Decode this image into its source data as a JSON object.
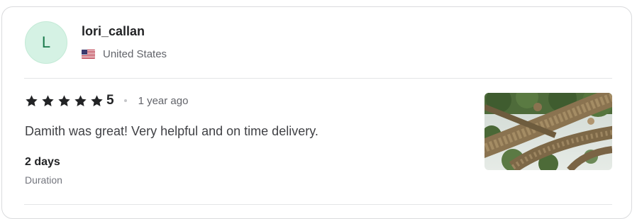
{
  "reviewer": {
    "avatar_initial": "L",
    "username": "lori_callan",
    "country": "United States",
    "flag_icon": "us-flag-icon"
  },
  "review": {
    "rating": "5",
    "stars_filled": 5,
    "stars_total": 5,
    "time_ago": "1 year ago",
    "text": "Damith was great! Very helpful and on time delivery.",
    "duration_value": "2 days",
    "duration_label": "Duration"
  },
  "colors": {
    "avatar_bg": "#d5f2e4",
    "avatar_text": "#1a7a4c",
    "star": "#222325",
    "card_border": "#dadbdd"
  },
  "icons": {
    "star": "star-icon",
    "separator": "dot-separator",
    "thumbnail": "review-image-thumbnail"
  }
}
